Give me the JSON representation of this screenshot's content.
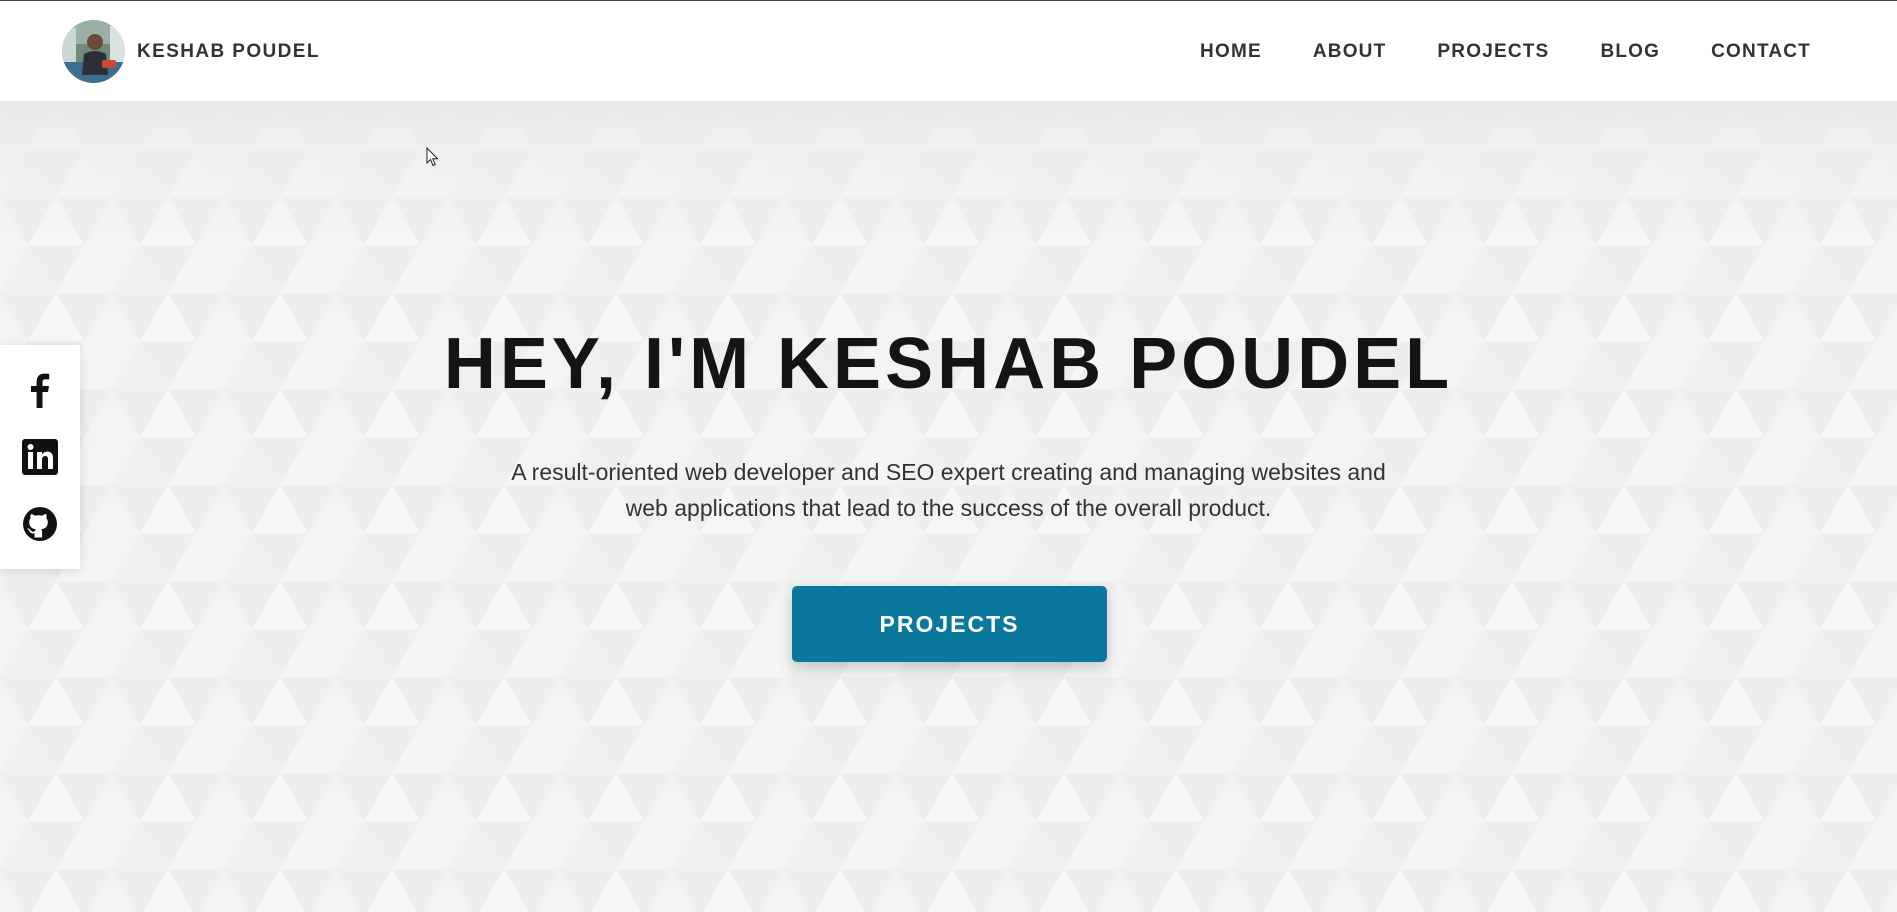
{
  "header": {
    "brand_name": "KESHAB POUDEL",
    "nav": [
      "HOME",
      "ABOUT",
      "PROJECTS",
      "BLOG",
      "CONTACT"
    ]
  },
  "hero": {
    "title": "HEY, I'M KESHAB POUDEL",
    "description": "A result-oriented web developer and SEO expert creating and managing websites and web applications that lead to the success of the overall product.",
    "cta_label": "PROJECTS"
  },
  "social": {
    "icons": [
      "facebook-icon",
      "linkedin-icon",
      "github-icon"
    ]
  },
  "colors": {
    "accent": "#0a789c",
    "background": "#f3f3f3",
    "header_bg": "#ffffff",
    "text_dark": "#141414"
  }
}
